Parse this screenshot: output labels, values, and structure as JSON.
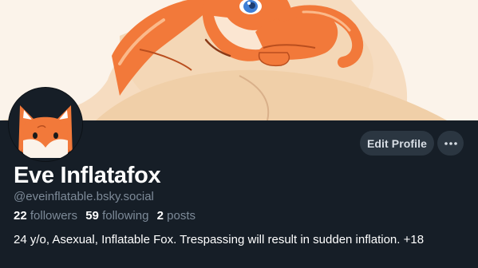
{
  "banner": {
    "image_name": "banner-fox-illustration"
  },
  "avatar": {
    "image_name": "fox-avatar"
  },
  "actions": {
    "edit_profile_label": "Edit Profile",
    "more_icon": "ellipsis-icon"
  },
  "profile": {
    "display_name": "Eve Inflatafox",
    "handle": "@eveinflatable.bsky.social",
    "followers_count": "22",
    "followers_label": "followers",
    "following_count": "59",
    "following_label": "following",
    "posts_count": "2",
    "posts_label": "posts",
    "bio": "24 y/o, Asexual, Inflatable Fox. Trespassing will result in sudden inflation. +18"
  },
  "colors": {
    "background": "#161e27",
    "button_bg": "#2b3641",
    "muted_text": "#7d8a98",
    "fox_orange": "#f2793a"
  }
}
